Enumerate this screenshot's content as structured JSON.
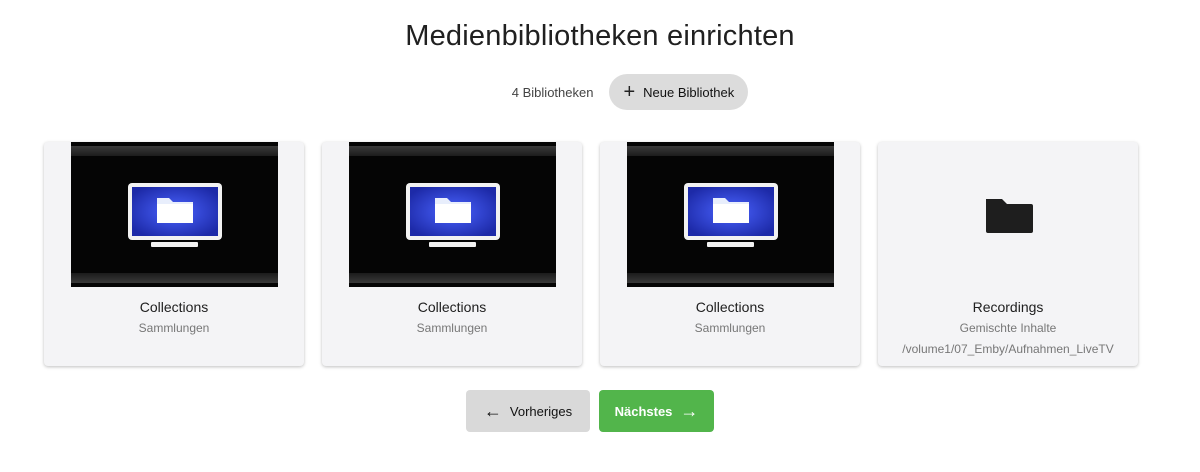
{
  "header": {
    "title": "Medienbibliotheken einrichten",
    "library_count": "4 Bibliotheken",
    "add_button_label": "Neue Bibliothek",
    "add_icon": "plus-icon"
  },
  "libraries": [
    {
      "title": "Collections",
      "type": "Sammlungen",
      "path": "",
      "icon": "monitor-folder-icon"
    },
    {
      "title": "Collections",
      "type": "Sammlungen",
      "path": "",
      "icon": "monitor-folder-icon"
    },
    {
      "title": "Collections",
      "type": "Sammlungen",
      "path": "",
      "icon": "monitor-folder-icon"
    },
    {
      "title": "Recordings",
      "type": "Gemischte Inhalte",
      "path": "/volume1/07_Emby/Aufnahmen_LiveTV",
      "icon": "folder-icon"
    }
  ],
  "navigation": {
    "prev_label": "Vorheriges",
    "next_label": "Nächstes",
    "prev_icon": "arrow-left-icon",
    "next_icon": "arrow-right-icon",
    "next_color": "#52b54b"
  },
  "colors": {
    "card_background": "#f4f4f6",
    "monitor_screen": "#2b3fd0"
  }
}
